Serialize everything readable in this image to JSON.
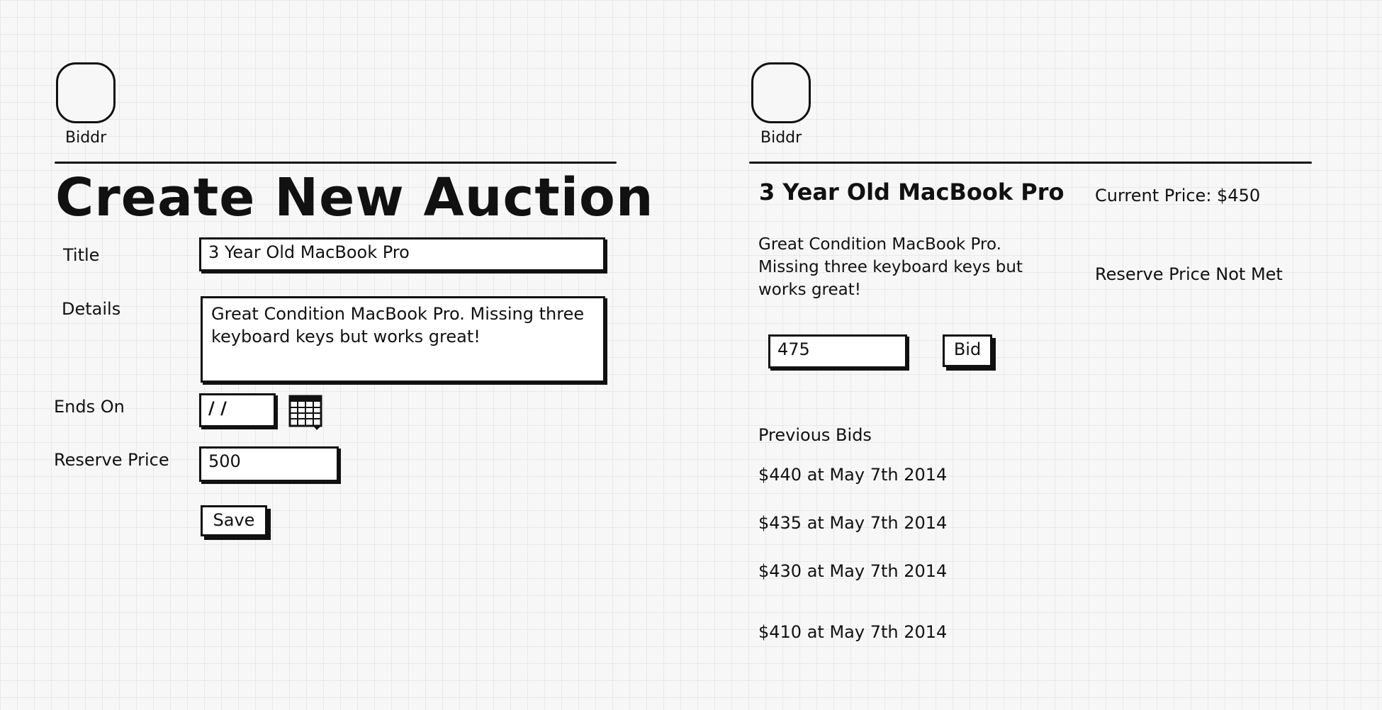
{
  "create_panel": {
    "logo_text": "Biddr",
    "title": "Create New Auction",
    "form": {
      "title_label": "Title",
      "title_value": "3 Year Old MacBook Pro",
      "details_label": "Details",
      "details_value": "Great Condition MacBook Pro. Missing three keyboard keys but works great!",
      "ends_on_label": "Ends On",
      "ends_on_value": " /  /",
      "calendar_icon": "calendar-icon",
      "reserve_label": "Reserve Price",
      "reserve_value": "500",
      "save_label": "Save"
    }
  },
  "view_panel": {
    "logo_text": "Biddr",
    "item_title": "3 Year Old MacBook Pro",
    "current_price": "Current Price: $450",
    "description": "Great Condition MacBook Pro. Missing three keyboard keys but works great!",
    "reserve_status": "Reserve Price Not Met",
    "bid_value": "475",
    "bid_label": "Bid",
    "previous_bids_label": "Previous Bids",
    "previous_bids": [
      "$440 at May 7th 2014",
      "$435 at May 7th 2014",
      "$430 at May 7th 2014",
      "$410 at May 7th 2014"
    ]
  }
}
